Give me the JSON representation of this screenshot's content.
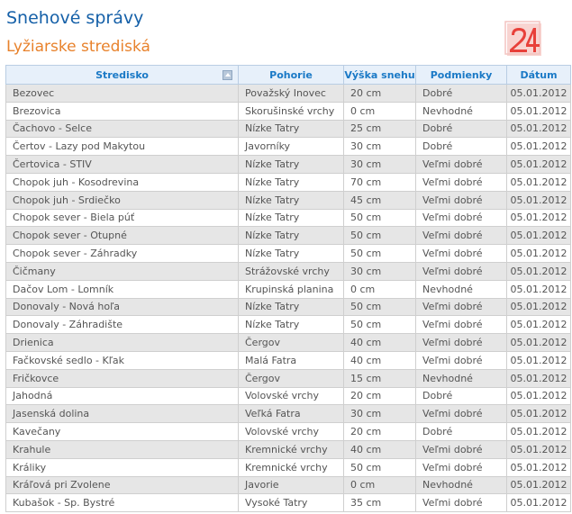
{
  "page": {
    "title": "Snehové správy",
    "subtitle": "Lyžiarske strediská"
  },
  "logo": {
    "text": "24",
    "color": "#e8403a"
  },
  "table": {
    "columns": [
      "Stredisko",
      "Pohorie",
      "Výška snehu",
      "Podmienky",
      "Dátum"
    ],
    "rows": [
      [
        "Bezovec",
        "Považský Inovec",
        "20 cm",
        "Dobré",
        "05.01.2012"
      ],
      [
        "Brezovica",
        "Skorušinské vrchy",
        "0 cm",
        "Nevhodné",
        "05.01.2012"
      ],
      [
        "Čachovo - Selce",
        "Nízke Tatry",
        "25 cm",
        "Dobré",
        "05.01.2012"
      ],
      [
        "Čertov - Lazy pod Makytou",
        "Javorníky",
        "30 cm",
        "Dobré",
        "05.01.2012"
      ],
      [
        "Čertovica - STIV",
        "Nízke Tatry",
        "30 cm",
        "Veľmi dobré",
        "05.01.2012"
      ],
      [
        "Chopok juh - Kosodrevina",
        "Nízke Tatry",
        "70 cm",
        "Veľmi dobré",
        "05.01.2012"
      ],
      [
        "Chopok juh - Srdiečko",
        "Nízke Tatry",
        "45 cm",
        "Veľmi dobré",
        "05.01.2012"
      ],
      [
        "Chopok sever - Biela púť",
        "Nízke Tatry",
        "50 cm",
        "Veľmi dobré",
        "05.01.2012"
      ],
      [
        "Chopok sever - Otupné",
        "Nízke Tatry",
        "50 cm",
        "Veľmi dobré",
        "05.01.2012"
      ],
      [
        "Chopok sever - Záhradky",
        "Nízke Tatry",
        "50 cm",
        "Veľmi dobré",
        "05.01.2012"
      ],
      [
        "Čičmany",
        "Strážovské vrchy",
        "30 cm",
        "Veľmi dobré",
        "05.01.2012"
      ],
      [
        "Dačov Lom - Lomník",
        "Krupinská planina",
        "0 cm",
        "Nevhodné",
        "05.01.2012"
      ],
      [
        "Donovaly - Nová hoľa",
        "Nízke Tatry",
        "50 cm",
        "Veľmi dobré",
        "05.01.2012"
      ],
      [
        "Donovaly - Záhradište",
        "Nízke Tatry",
        "50 cm",
        "Veľmi dobré",
        "05.01.2012"
      ],
      [
        "Drienica",
        "Čergov",
        "40 cm",
        "Veľmi dobré",
        "05.01.2012"
      ],
      [
        "Fačkovské sedlo - Kľak",
        "Malá Fatra",
        "40 cm",
        "Veľmi dobré",
        "05.01.2012"
      ],
      [
        "Fričkovce",
        "Čergov",
        "15 cm",
        "Nevhodné",
        "05.01.2012"
      ],
      [
        "Jahodná",
        "Volovské vrchy",
        "20 cm",
        "Dobré",
        "05.01.2012"
      ],
      [
        "Jasenská dolina",
        "Veľká Fatra",
        "30 cm",
        "Veľmi dobré",
        "05.01.2012"
      ],
      [
        "Kavečany",
        "Volovské vrchy",
        "20 cm",
        "Dobré",
        "05.01.2012"
      ],
      [
        "Krahule",
        "Kremnické vrchy",
        "40 cm",
        "Veľmi dobré",
        "05.01.2012"
      ],
      [
        "Králiky",
        "Kremnické vrchy",
        "50 cm",
        "Veľmi dobré",
        "05.01.2012"
      ],
      [
        "Kráľová pri Zvolene",
        "Javorie",
        "0 cm",
        "Nevhodné",
        "05.01.2012"
      ],
      [
        "Kubašok - Sp. Bystré",
        "Vysoké Tatry",
        "35 cm",
        "Veľmi dobré",
        "05.01.2012"
      ]
    ]
  },
  "colors": {
    "title": "#1560a8",
    "subtitle": "#e8822c",
    "header_text": "#1a79c6",
    "header_bg": "#e7f0fa",
    "row_alt": "#e6e6e6"
  },
  "icons": {
    "sort": "sort-ascending-icon"
  }
}
